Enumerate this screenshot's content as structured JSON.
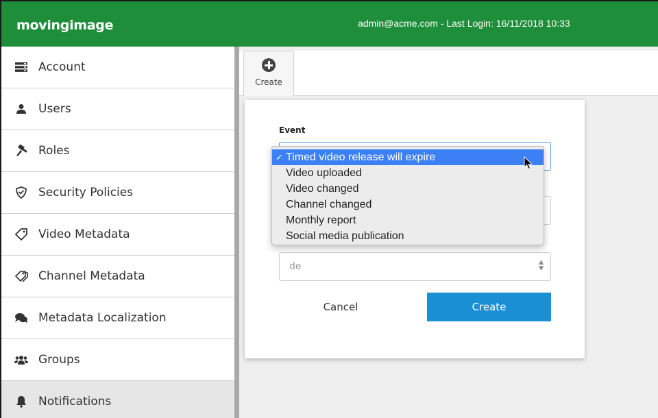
{
  "header": {
    "logo": "movingimage",
    "login_info": "admin@acme.com - Last Login: 16/11/2018 10:33",
    "background_color": "#1f8e3a"
  },
  "sidebar": {
    "items": [
      {
        "label": "Account",
        "icon": "server-icon"
      },
      {
        "label": "Users",
        "icon": "user-icon"
      },
      {
        "label": "Roles",
        "icon": "gavel-icon"
      },
      {
        "label": "Security Policies",
        "icon": "shield-icon"
      },
      {
        "label": "Video Metadata",
        "icon": "tag-icon"
      },
      {
        "label": "Channel Metadata",
        "icon": "tags-icon"
      },
      {
        "label": "Metadata Localization",
        "icon": "chat-icon"
      },
      {
        "label": "Groups",
        "icon": "group-icon"
      },
      {
        "label": "Notifications",
        "icon": "bell-icon",
        "active": true
      }
    ]
  },
  "toolbar": {
    "create_label": "Create",
    "create_icon": "plus-circle-icon"
  },
  "dialog": {
    "event_label": "Event",
    "language_value": "de",
    "cancel_label": "Cancel",
    "create_label": "Create",
    "create_color": "#1a8fd3"
  },
  "event_dropdown": {
    "selected": "Timed video release will expire",
    "options": [
      "Timed video release will expire",
      "Video uploaded",
      "Video changed",
      "Channel changed",
      "Monthly report",
      "Social media publication"
    ],
    "check_mark": "✓"
  }
}
